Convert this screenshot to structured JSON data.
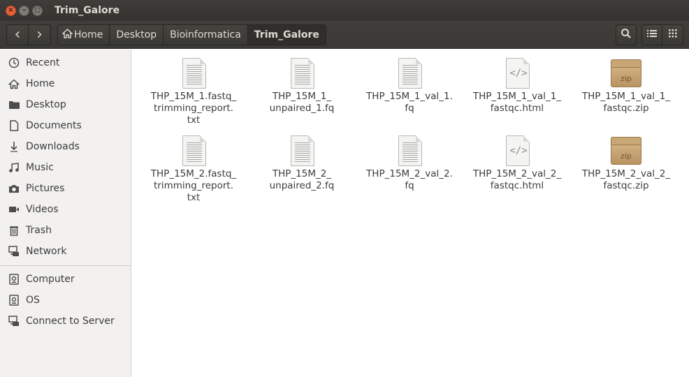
{
  "window": {
    "title": "Trim_Galore",
    "close_glyph": "×",
    "min_glyph": "–",
    "max_glyph": "□"
  },
  "toolbar": {
    "back_glyph": "‹",
    "forward_glyph": "›",
    "breadcrumbs": [
      {
        "label": "Home",
        "icon": "home-icon"
      },
      {
        "label": "Desktop"
      },
      {
        "label": "Bioinformatica"
      },
      {
        "label": "Trim_Galore",
        "active": true
      }
    ],
    "search_icon": "search-icon",
    "list_view_icon": "list-view-icon",
    "grid_view_icon": "grid-view-icon"
  },
  "sidebar": {
    "places": [
      {
        "label": "Recent",
        "icon": "recent-icon"
      },
      {
        "label": "Home",
        "icon": "home-icon"
      },
      {
        "label": "Desktop",
        "icon": "folder-icon"
      },
      {
        "label": "Documents",
        "icon": "document-icon"
      },
      {
        "label": "Downloads",
        "icon": "download-icon"
      },
      {
        "label": "Music",
        "icon": "music-icon"
      },
      {
        "label": "Pictures",
        "icon": "camera-icon"
      },
      {
        "label": "Videos",
        "icon": "video-icon"
      },
      {
        "label": "Trash",
        "icon": "trash-icon"
      },
      {
        "label": "Network",
        "icon": "network-icon"
      }
    ],
    "devices": [
      {
        "label": "Computer",
        "icon": "drive-icon"
      },
      {
        "label": "OS",
        "icon": "drive-icon"
      },
      {
        "label": "Connect to Server",
        "icon": "server-icon"
      }
    ]
  },
  "files": [
    {
      "lines": [
        "THP_15M_1.fastq_",
        "trimming_report.",
        "txt"
      ],
      "type": "text"
    },
    {
      "lines": [
        "THP_15M_1_",
        "unpaired_1.fq"
      ],
      "type": "text"
    },
    {
      "lines": [
        "THP_15M_1_val_1.",
        "fq"
      ],
      "type": "text"
    },
    {
      "lines": [
        "THP_15M_1_val_1_",
        "fastqc.html"
      ],
      "type": "html"
    },
    {
      "lines": [
        "THP_15M_1_val_1_",
        "fastqc.zip"
      ],
      "type": "zip",
      "badge": "zip"
    },
    {
      "lines": [
        "THP_15M_2.fastq_",
        "trimming_report.",
        "txt"
      ],
      "type": "text"
    },
    {
      "lines": [
        "THP_15M_2_",
        "unpaired_2.fq"
      ],
      "type": "text"
    },
    {
      "lines": [
        "THP_15M_2_val_2.",
        "fq"
      ],
      "type": "text"
    },
    {
      "lines": [
        "THP_15M_2_val_2_",
        "fastqc.html"
      ],
      "type": "html"
    },
    {
      "lines": [
        "THP_15M_2_val_2_",
        "fastqc.zip"
      ],
      "type": "zip",
      "badge": "zip"
    }
  ],
  "html_icon_glyph": "</>"
}
